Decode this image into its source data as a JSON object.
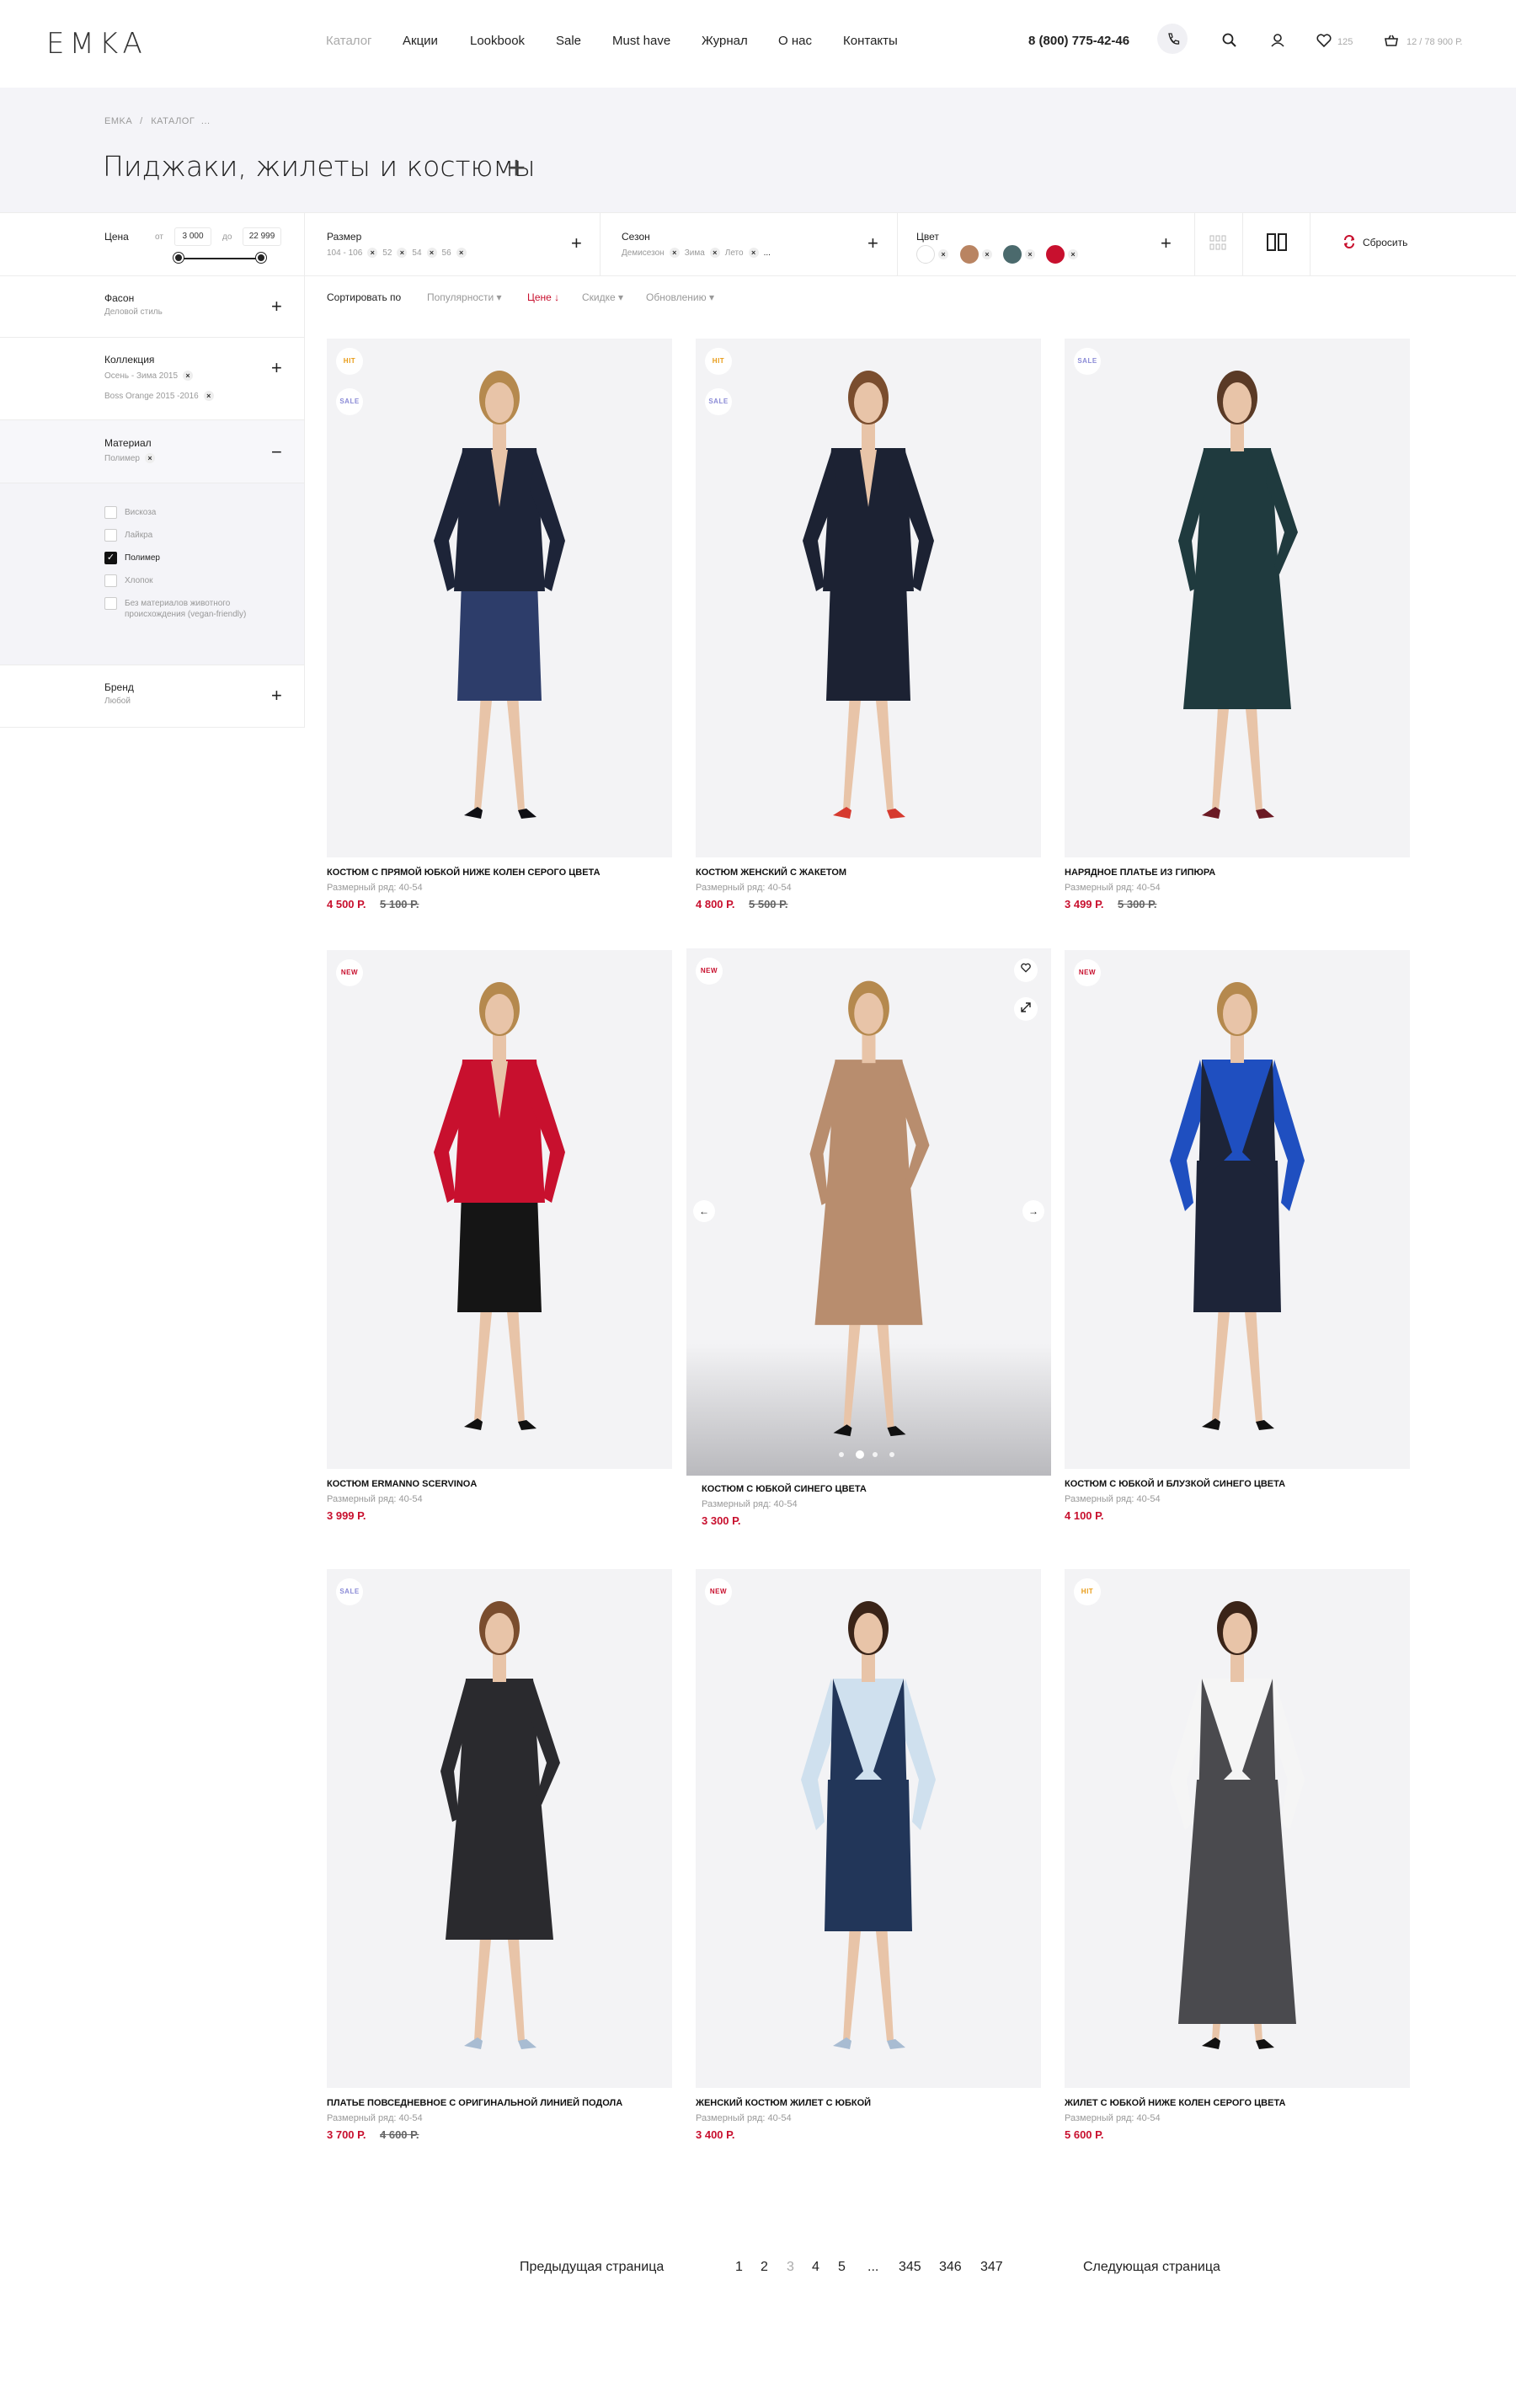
{
  "header": {
    "logo": "EMKA",
    "nav": [
      "Каталог",
      "Акции",
      "Lookbook",
      "Sale",
      "Must have",
      "Журнал",
      "О нас",
      "Контакты"
    ],
    "phone": "8 (800) 775-42-46",
    "icons": {
      "phone": "phone-icon",
      "search": "search-icon",
      "user": "user-icon",
      "favorites": "heart-icon",
      "cart": "bag-icon"
    },
    "favorites_count": "125",
    "cart_summary": "12 / 78 900 Р."
  },
  "breadcrumb": {
    "home": "EMKA",
    "sep": "/",
    "current": "КАТАЛОГ",
    "more": "..."
  },
  "page_title": "Пиджаки, жилеты и костюмы",
  "filters": {
    "price": {
      "label": "Цена",
      "from_label": "от",
      "from": "3 000",
      "to_label": "до",
      "to": "22 999"
    },
    "size": {
      "label": "Размер",
      "values": [
        "104 - 106",
        "52",
        "54",
        "56"
      ]
    },
    "season": {
      "label": "Сезон",
      "values": [
        "Демисезон",
        "Зима",
        "Лето",
        "..."
      ]
    },
    "color": {
      "label": "Цвет",
      "colors": [
        "#ffffff",
        "#b98462",
        "#4b6a6d",
        "#c8102e"
      ]
    },
    "reset": "Сбросить"
  },
  "sidebar": {
    "style": {
      "title": "Фасон",
      "value": "Деловой стиль"
    },
    "collection": {
      "title": "Коллекция",
      "values": [
        "Осень - Зима 2015",
        "Boss Orange 2015 -2016"
      ]
    },
    "material": {
      "title": "Материал",
      "value": "Полимер",
      "options": [
        {
          "label": "Вискоза",
          "checked": false
        },
        {
          "label": "Лайкра",
          "checked": false
        },
        {
          "label": "Полимер",
          "checked": true
        },
        {
          "label": "Хлопок",
          "checked": false
        },
        {
          "label": "Без материалов животного происхождения (vegan-friendly)",
          "checked": false
        }
      ]
    },
    "brand": {
      "title": "Бренд",
      "value": "Любой"
    }
  },
  "sort": {
    "label": "Сортировать по",
    "options": [
      "Популярности ▾",
      "Цене ↓",
      "Скидке ▾",
      "Обновлению ▾"
    ]
  },
  "products": [
    {
      "name": "Костюм с прямой юбкой ниже колен серого цвета",
      "size": "Размерный ряд: 40-54",
      "price": "4 500 Р.",
      "old": "5 100 Р.",
      "badges": [
        "HIT",
        "SALE"
      ],
      "colors": [
        "#1d2438",
        "#2d3d6a",
        "#0f0f14"
      ],
      "skin": "#e8c4a8",
      "hair": "#b5894e",
      "garment": "jacket-skirt"
    },
    {
      "name": "Костюм женский с жакетом",
      "size": "Размерный ряд: 40-54",
      "price": "4 800 Р.",
      "old": "5 500 Р.",
      "badges": [
        "HIT",
        "SALE"
      ],
      "colors": [
        "#1c2233",
        "#1c2233",
        "#d63a2f"
      ],
      "skin": "#e8c4a8",
      "hair": "#7a4d2e",
      "garment": "jacket-skirt"
    },
    {
      "name": "Нарядное платье из гипюра",
      "size": "Размерный ряд: 40-54",
      "price": "3 499 Р.",
      "old": "5 300 Р.",
      "badges": [
        "SALE"
      ],
      "colors": [
        "#1f3a3e",
        "#1f3a3e",
        "#6b1a24"
      ],
      "skin": "#e8c4a8",
      "hair": "#5a3a26",
      "garment": "dress"
    },
    {
      "name": "Костюм Ermanno Scervinoa",
      "size": "Размерный ряд: 40-54",
      "price": "3 999 Р.",
      "old": "",
      "badges": [
        "NEW"
      ],
      "colors": [
        "#c8102e",
        "#151515",
        "#111111"
      ],
      "skin": "#e8c4a8",
      "hair": "#b5894e",
      "garment": "jacket-skirt"
    },
    {
      "name": "Костюм с юбкой синего цвета",
      "size": "Размерный ряд: 40-54",
      "price": "3 300 Р.",
      "old": "",
      "badges": [
        "NEW"
      ],
      "colors": [
        "#b88d6e",
        "#b88d6e",
        "#111111"
      ],
      "skin": "#e8c4a8",
      "hair": "#b5894e",
      "garment": "dress"
    },
    {
      "name": "Костюм с юбкой и блузкой синего цвета",
      "size": "Размерный ряд: 40-54",
      "price": "4 100 Р.",
      "old": "",
      "badges": [
        "NEW"
      ],
      "colors": [
        "#1d2438",
        "#1f4fc0",
        "#111111"
      ],
      "skin": "#e8c4a8",
      "hair": "#b5894e",
      "garment": "vest-skirt"
    },
    {
      "name": "Платье повседневное с оригинальной линией подола",
      "size": "Размерный ряд: 40-54",
      "price": "3 700 Р.",
      "old": "4 600 Р.",
      "badges": [
        "SALE"
      ],
      "colors": [
        "#2a2a2e",
        "#2a2a2e",
        "#a8bcd2"
      ],
      "skin": "#e8c4a8",
      "hair": "#7a4d2e",
      "garment": "dress"
    },
    {
      "name": "Женский костюм жилет с юбкой",
      "size": "Размерный ряд: 40-54",
      "price": "3 400 Р.",
      "old": "",
      "badges": [
        "NEW"
      ],
      "colors": [
        "#223659",
        "#cfe0ee",
        "#a8bcd2"
      ],
      "skin": "#e8c4a8",
      "hair": "#3a2418",
      "garment": "vest-skirt"
    },
    {
      "name": "Жилет с юбкой ниже колен серого цвета",
      "size": "Размерный ряд: 40-54",
      "price": "5 600 Р.",
      "old": "",
      "badges": [
        "HIT"
      ],
      "colors": [
        "#4a4a4e",
        "#f5f5f5",
        "#111111"
      ],
      "skin": "#e8c4a8",
      "hair": "#3a2418",
      "garment": "vest-long"
    }
  ],
  "pagination": {
    "prev": "Предыдущая страница",
    "pages": [
      "1",
      "2",
      "3",
      "4",
      "5",
      "...",
      "345",
      "346",
      "347"
    ],
    "current": "3",
    "next": "Следующая страница"
  },
  "brand_color": "#c8102e"
}
